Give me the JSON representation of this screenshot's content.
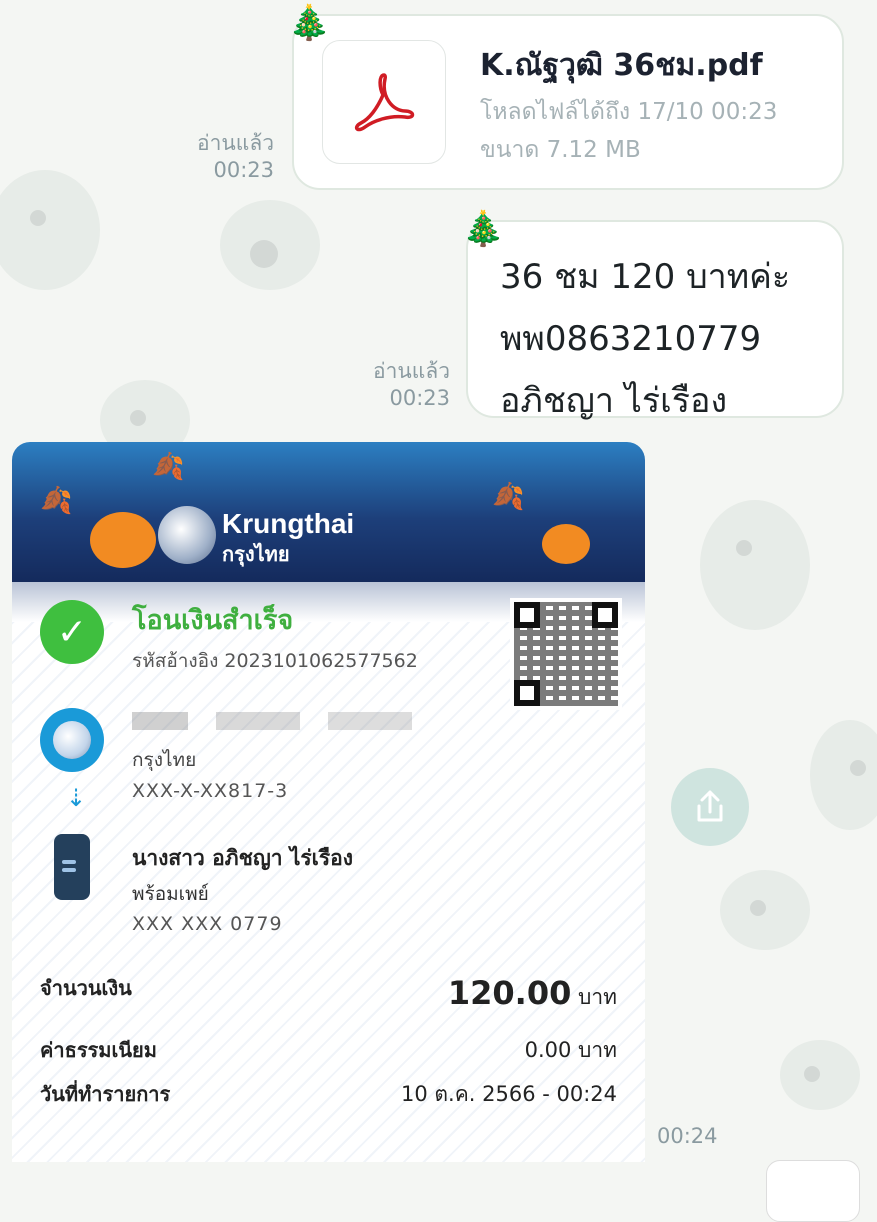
{
  "messages": [
    {
      "type": "file",
      "file_name": "K.ณัฐวุฒิ 36ชม.pdf",
      "download_until": "โหลดไฟล์ได้ถึง 17/10 00:23",
      "size": "ขนาด 7.12 MB",
      "read_label": "อ่านแล้ว",
      "time": "00:23"
    },
    {
      "type": "text",
      "lines": [
        "36 ชม 120 บาทค่ะ",
        "พพ0863210779",
        "อภิชญา ไร่เรือง"
      ],
      "read_label": "อ่านแล้ว",
      "time": "00:23"
    },
    {
      "type": "image",
      "time": "00:24"
    }
  ],
  "slip": {
    "brand_en": "Krungthai",
    "brand_th": "กรุงไทย",
    "status": "โอนเงินสำเร็จ",
    "reference": "รหัสอ้างอิง 2023101062577562",
    "sender": {
      "bank": "กรุงไทย",
      "account": "XXX-X-XX817-3"
    },
    "receiver": {
      "name": "นางสาว อภิชญา ไร่เรือง",
      "channel": "พร้อมเพย์",
      "account": "XXX XXX 0779"
    },
    "amount_label": "จำนวนเงิน",
    "amount": "120.00",
    "amount_unit": "บาท",
    "fee_label": "ค่าธรรมเนียม",
    "fee": "0.00 บาท",
    "date_label": "วันที่ทำรายการ",
    "date": "10 ต.ค. 2566 - 00:24"
  },
  "icons": {
    "pdf": "acrobat-icon",
    "share": "share-icon",
    "decoration": "christmas-tree-icon"
  }
}
